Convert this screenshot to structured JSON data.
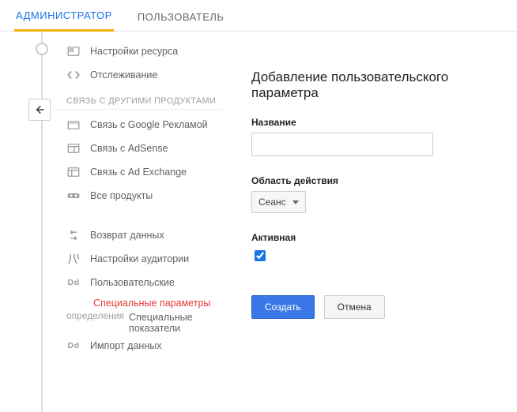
{
  "tabs": {
    "admin": "АДМИНИСТРАТОР",
    "user": "ПОЛЬЗОВАТЕЛЬ"
  },
  "sidebar": {
    "resource_settings": "Настройки ресурса",
    "tracking": "Отслеживание",
    "link_section": "СВЯЗЬ С ДРУГИМИ ПРОДУКТАМИ",
    "google_ads": "Связь с Google Рекламой",
    "adsense": "Связь с AdSense",
    "adexchange": "Связь с Ad Exchange",
    "all_products": "Все продукты",
    "data_return": "Возврат данных",
    "audience_settings": "Настройки аудитории",
    "custom": "Пользовательские",
    "definitions_trailing": "определения",
    "custom_params": "Специальные параметры",
    "custom_metrics": "Специальные показатели",
    "data_import": "Импорт данных",
    "dd": "Dd"
  },
  "content": {
    "title": "Добавление пользовательского параметра",
    "name_label": "Название",
    "name_value": "",
    "scope_label": "Область действия",
    "scope_value": "Сеанс",
    "active_label": "Активная",
    "active_checked": true,
    "create_btn": "Создать",
    "cancel_btn": "Отмена"
  }
}
